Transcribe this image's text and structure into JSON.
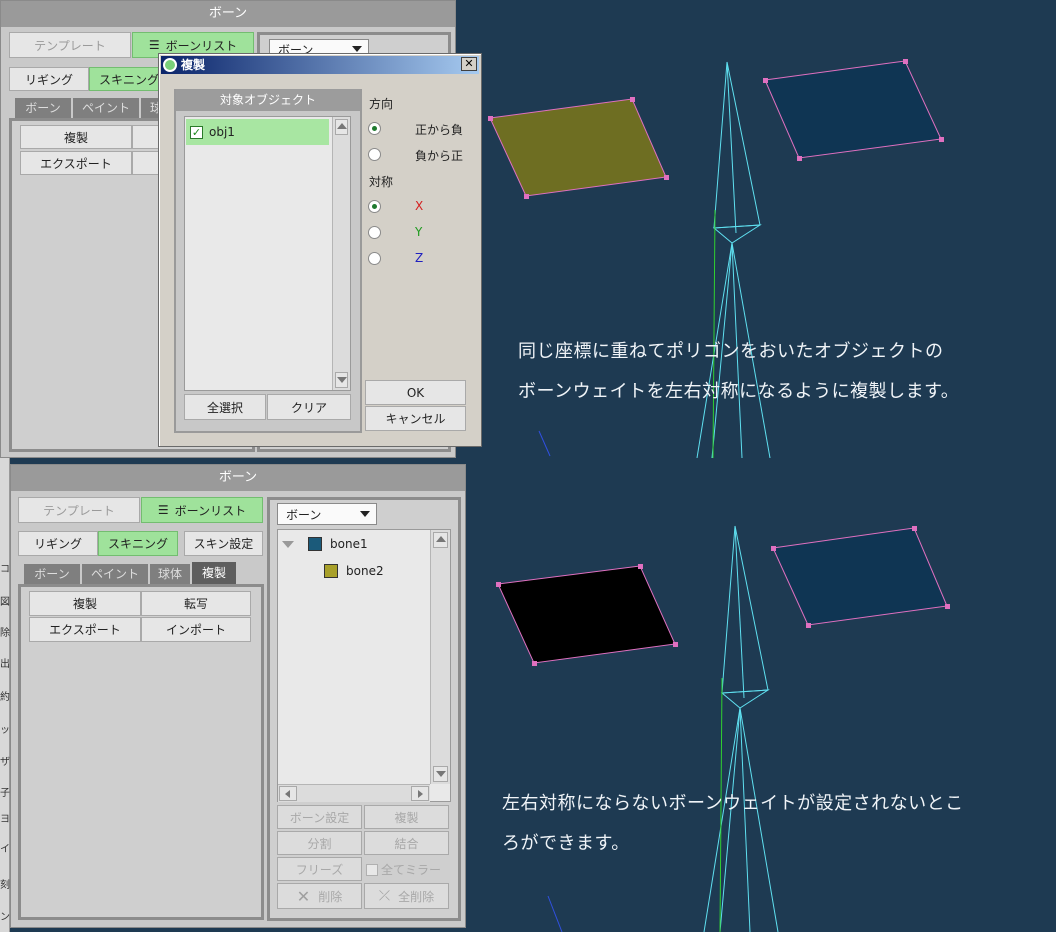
{
  "top_panel": {
    "title": "ボーン",
    "template_label": "テンプレート",
    "bone_list_label": "ボーンリスト",
    "select_value": "ボーン",
    "rigging_label": "リギング",
    "skinning_label": "スキニング",
    "tabs": [
      "ボーン",
      "ペイント",
      "球"
    ],
    "duplicate_label": "複製",
    "export_label": "エクスポート"
  },
  "dialog": {
    "title": "複製",
    "close_glyph": "✕",
    "target_header": "対象オブジェクト",
    "objects": [
      {
        "name": "obj1",
        "checked": true
      }
    ],
    "direction_label": "方向",
    "direction_options": [
      "正から負",
      "負から正"
    ],
    "direction_selected": 0,
    "symmetry_label": "対称",
    "axis_options": [
      {
        "label": "X",
        "color": "#d42020"
      },
      {
        "label": "Y",
        "color": "#1f9a1f"
      },
      {
        "label": "Z",
        "color": "#2020c0"
      }
    ],
    "axis_selected": 0,
    "select_all_label": "全選択",
    "clear_label": "クリア",
    "ok_label": "OK",
    "cancel_label": "キャンセル"
  },
  "bottom_panel": {
    "title": "ボーン",
    "template_label": "テンプレート",
    "bone_list_label": "ボーンリスト",
    "rigging_label": "リギング",
    "skinning_label": "スキニング",
    "skin_settings_label": "スキン設定",
    "tabs": [
      "ボーン",
      "ペイント",
      "球体",
      "複製"
    ],
    "active_tab": 3,
    "duplicate_label": "複製",
    "transfer_label": "転写",
    "export_label": "エクスポート",
    "import_label": "インポート",
    "select_value": "ボーン",
    "tree": [
      {
        "name": "bone1",
        "color": "#1b5a7a",
        "level": 0
      },
      {
        "name": "bone2",
        "color": "#a8a02a",
        "level": 1
      }
    ],
    "bone_settings_label": "ボーン設定",
    "dup_label": "複製",
    "split_label": "分割",
    "merge_label": "結合",
    "freeze_label": "フリーズ",
    "mirror_all_label": "全てミラー",
    "delete_label": "削除",
    "delete_all_label": "全削除"
  },
  "viewport_top": {
    "caption_line1": "同じ座標に重ねてポリゴンをおいたオブジェクトの",
    "caption_line2": "ボーンウェイトを左右対称になるように複製します。",
    "left_poly_color": "#6e6e22",
    "right_poly_color": "#0f3553"
  },
  "viewport_bottom": {
    "caption_line1": "左右対称にならないボーンウェイトが設定されないとこ",
    "caption_line2": "ろができます。",
    "left_poly_color": "#000000",
    "right_poly_color": "#0f3553"
  },
  "left_strip_chars": [
    "コ",
    "図",
    "除",
    "出",
    "約",
    "ッ",
    "ザ",
    "子",
    "ヨ",
    "イ",
    "刻",
    "ン"
  ],
  "colors": {
    "bone_wire": "#5fe0f0",
    "vertex": "#e070c0",
    "edge": "#e070c0",
    "axis_line": "#30d030",
    "background": "#1e3a52"
  }
}
